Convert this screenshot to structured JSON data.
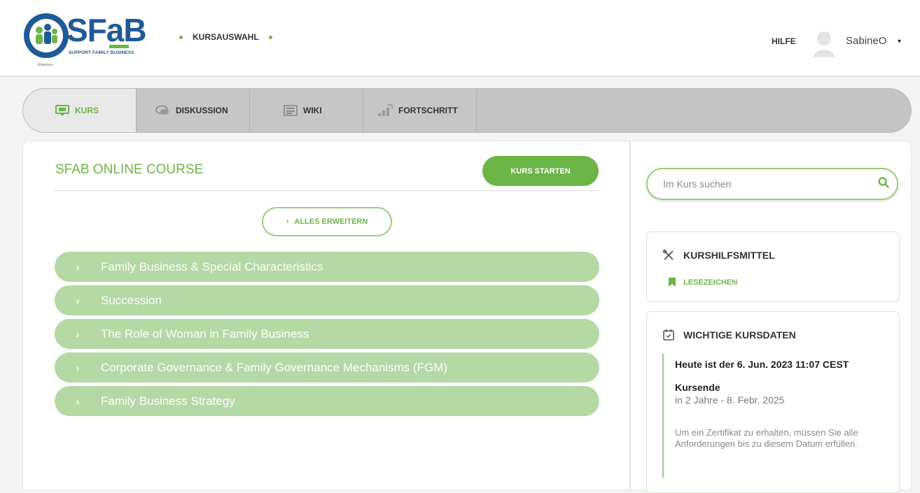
{
  "header": {
    "logo_text": "SFaB",
    "logo_subtitle": "SUPPORT FAMILY BUSINESS",
    "logo_small_text": "Erasmus+",
    "nav_item": "KURSAUSWAHL",
    "help": "HILFE",
    "username": "SabineO",
    "user_caret": "▾"
  },
  "tabs": [
    {
      "label": "KURS",
      "icon": "monitor-icon",
      "active": true
    },
    {
      "label": "DISKUSSION",
      "icon": "chat-icon",
      "active": false
    },
    {
      "label": "WIKI",
      "icon": "wiki-icon",
      "active": false
    },
    {
      "label": "FORTSCHRITT",
      "icon": "progress-icon",
      "active": false
    }
  ],
  "course": {
    "title": "SFAB ONLINE COURSE",
    "start_button": "KURS STARTEN",
    "expand_button": "ALLES ERWEITERN",
    "sections": [
      "Family Business & Special Characteristics",
      "Succession",
      "The Role of Woman in Family Business",
      "Corporate Governance & Family Governance Mechanisms (FGM)",
      "Family Business Strategy"
    ]
  },
  "sidebar": {
    "search_placeholder": "Im Kurs suchen",
    "tools_title": "KURSHILFSMITTEL",
    "bookmarks": "LESEZEICHEN",
    "dates_title": "WICHTIGE KURSDATEN",
    "today": "Heute ist der 6. Jun. 2023 11:07 CEST",
    "end_label": "Kursende",
    "end_value": "in 2 Jahre - 8. Febr. 2025",
    "end_note": "Um ein Zertifikat zu erhalten, müssen Sie alle Anforderungen bis zu diesem Datum erfüllen."
  },
  "colors": {
    "accent": "#6cb547",
    "section_bg": "#b4d9a4",
    "logo_blue": "#1f5a96"
  }
}
